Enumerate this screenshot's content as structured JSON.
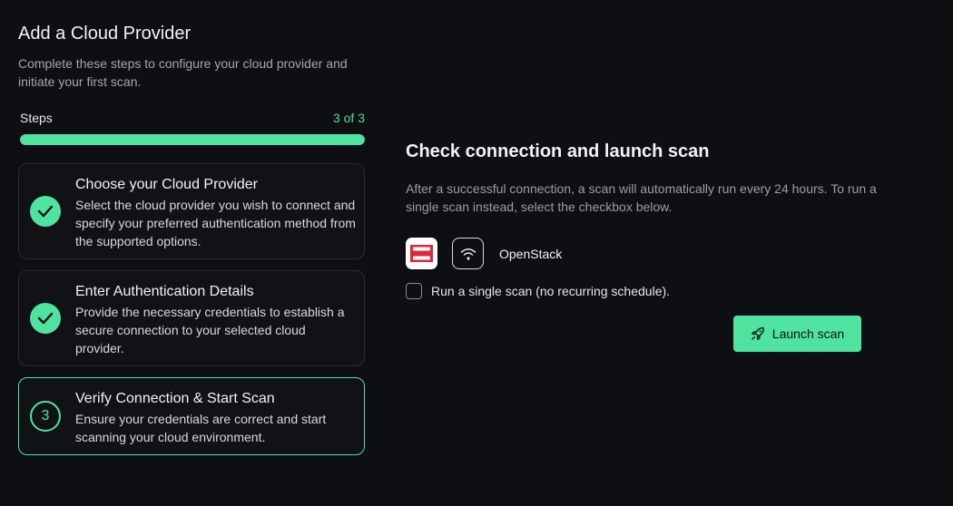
{
  "header": {
    "title": "Add a Cloud Provider",
    "subtitle": "Complete these steps to configure your cloud provider and initiate your first scan."
  },
  "progress": {
    "label": "Steps",
    "count_text": "3 of 3",
    "fraction": 1.0
  },
  "steps": [
    {
      "title": "Choose your Cloud Provider",
      "description": "Select the cloud provider you wish to connect and specify your preferred authentication method from the supported options.",
      "status": "done"
    },
    {
      "title": "Enter Authentication Details",
      "description": "Provide the necessary credentials to establish a secure connection to your selected cloud provider.",
      "status": "done"
    },
    {
      "number": "3",
      "title": "Verify Connection & Start Scan",
      "description": "Ensure your credentials are correct and start scanning your cloud environment.",
      "status": "current"
    }
  ],
  "main": {
    "title": "Check connection and launch scan",
    "description": "After a successful connection, a scan will automatically run every 24 hours. To run a single scan instead, select the checkbox below.",
    "provider": {
      "name": "OpenStack",
      "logo_icon": "openstack-logo",
      "status_icon": "wifi-icon"
    },
    "checkbox_label": "Run a single scan (no recurring schedule).",
    "checkbox_checked": false,
    "launch_button": "Launch scan"
  },
  "colors": {
    "accent": "#4fe3a0",
    "background": "#0e0f12",
    "openstack_red": "#e0263a"
  }
}
